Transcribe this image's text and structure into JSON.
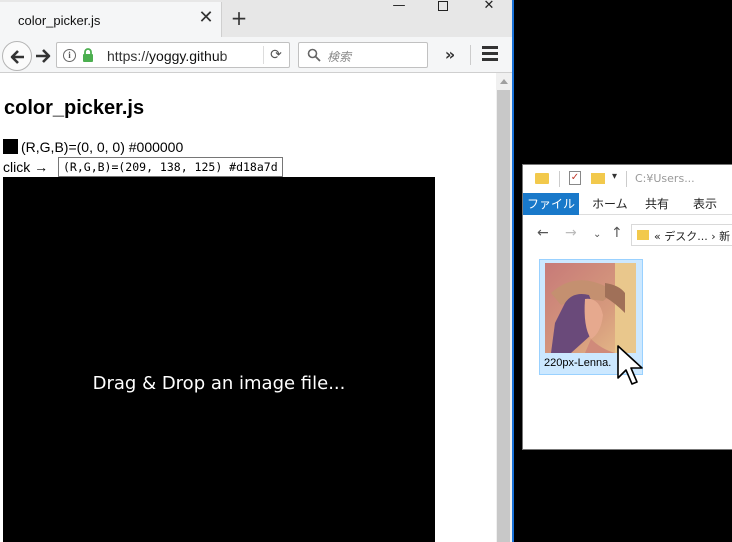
{
  "browser": {
    "tab_title": "color_picker.js",
    "tab_close": "✕",
    "new_tab": "+",
    "window_min": "—",
    "window_close": "✕",
    "url_scheme": "https://",
    "url_host": "yoggy.github",
    "search_placeholder": "検索",
    "overflow": "»",
    "reload": "⟳"
  },
  "page": {
    "title": "color_picker.js",
    "rgb_line": "(R,G,B)=(0, 0, 0) #000000",
    "click_label": "click →",
    "tooltip": "(R,G,B)=(209, 138, 125) #d18a7d",
    "drop_hint": "Drag & Drop an image file...",
    "swatch_color": "#000000"
  },
  "explorer": {
    "title_path": "C:¥Users...",
    "ribbon": {
      "file": "ファイル",
      "home": "ホーム",
      "share": "共有",
      "view": "表示"
    },
    "address": "« デスク... › 新",
    "file_name": "220px-Lenna.",
    "selection_color": "#cce8ff",
    "accent": "#1979ca"
  }
}
